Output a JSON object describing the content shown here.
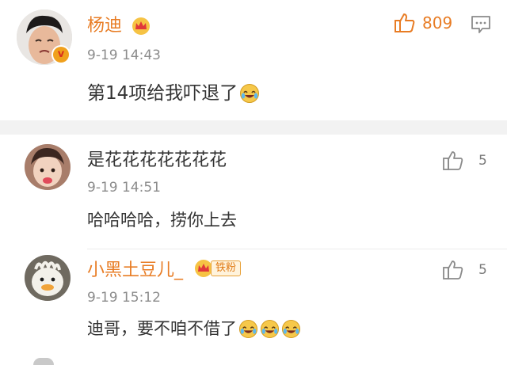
{
  "top_comment": {
    "username": "杨迪",
    "time": "9-19 14:43",
    "text": "第14项给我吓退了",
    "likes": "809",
    "verified_mark": "v",
    "emoji": "laugh-cry-emoji"
  },
  "replies": [
    {
      "username": "是花花花花花花花",
      "time": "9-19 14:51",
      "text": "哈哈哈哈，捞你上去",
      "likes": "5"
    },
    {
      "username": "小黑土豆儿_",
      "badge": "铁粉",
      "time": "9-19 15:12",
      "text": "迪哥，要不咱不借了",
      "likes": "5",
      "emoji_count": 3
    }
  ],
  "colors": {
    "username_vip": "#e87c24",
    "text": "#333333",
    "time": "#8c8c8c",
    "separator": "#f2f2f2",
    "like_hot": "#e87c24"
  }
}
